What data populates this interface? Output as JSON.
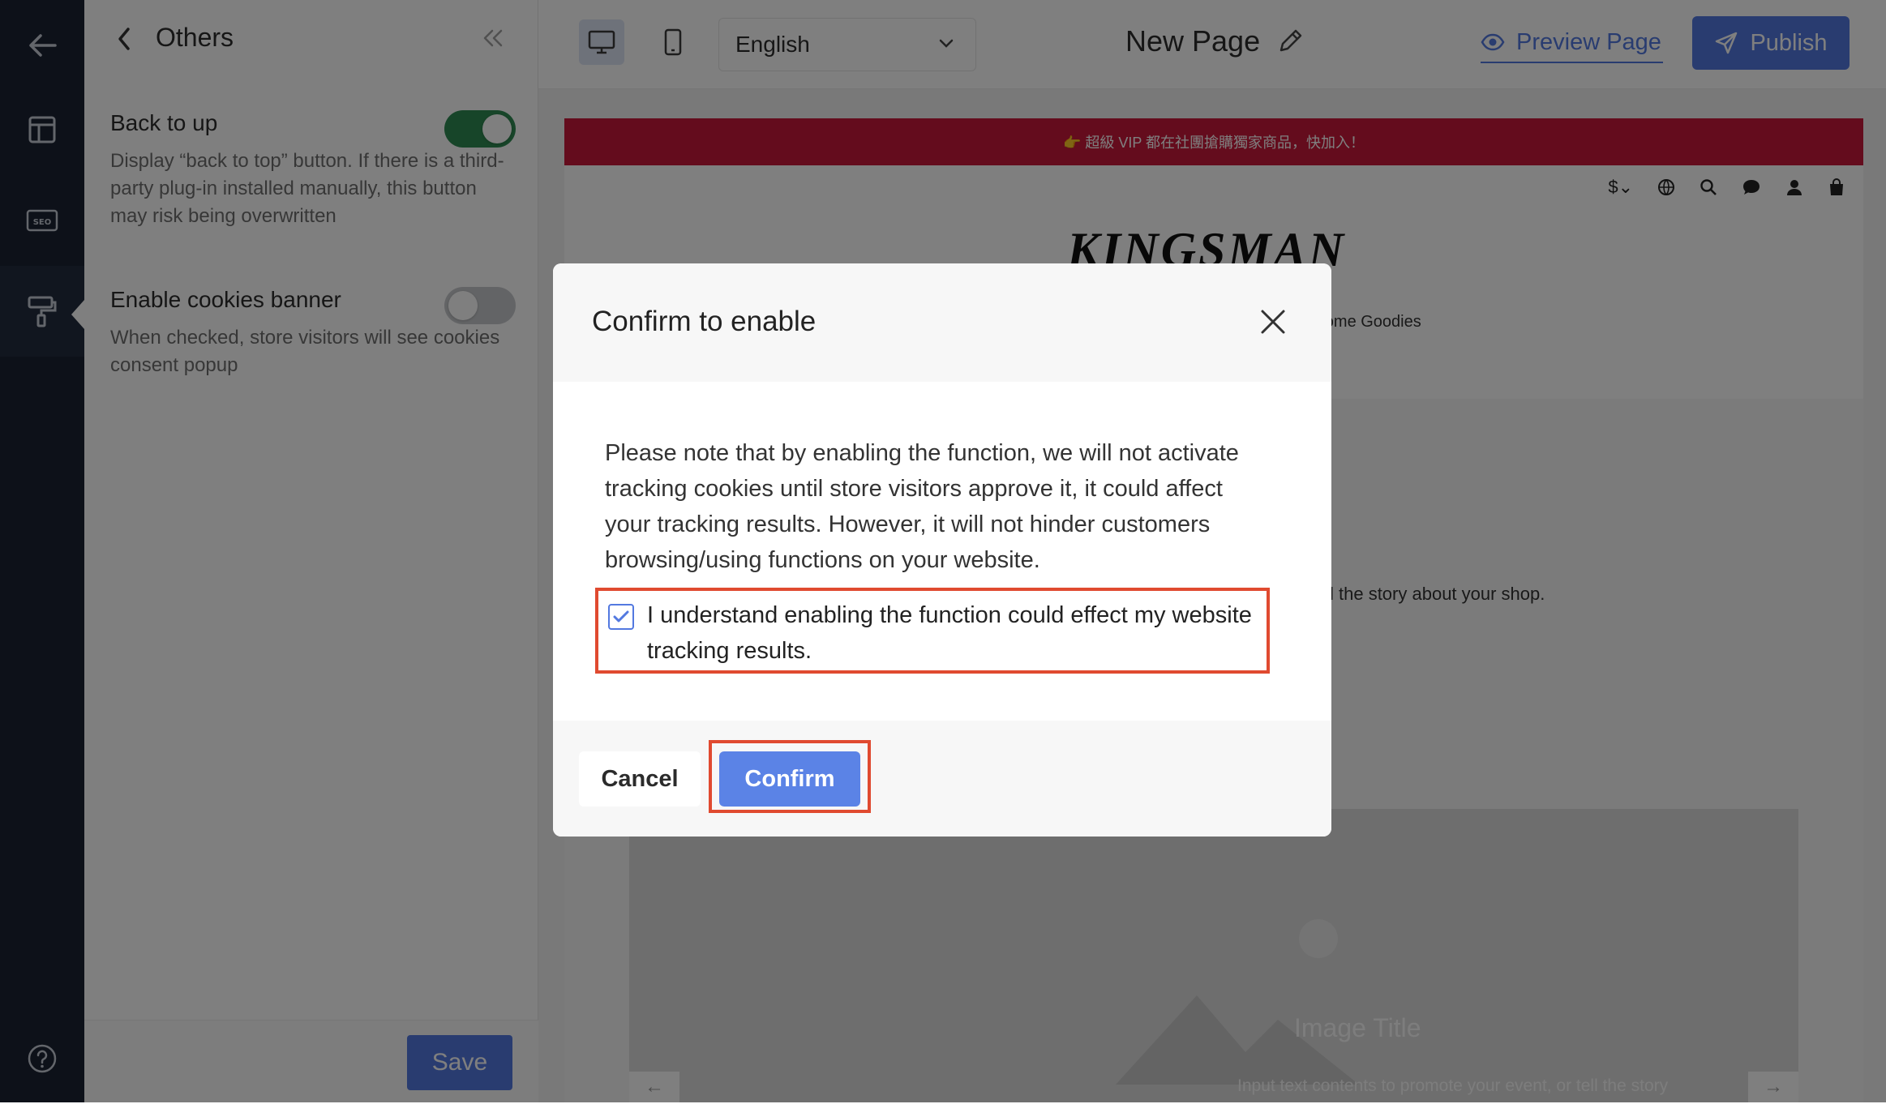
{
  "panel": {
    "title": "Others",
    "settings": [
      {
        "label": "Back to up",
        "description": "Display “back to top” button. If there is a third-party plug-in installed manually, this button may risk being overwritten",
        "enabled": true
      },
      {
        "label": "Enable cookies banner",
        "description": "When checked, store visitors will see cookies consent popup",
        "enabled": false
      }
    ],
    "save_label": "Save"
  },
  "topbar": {
    "language": "English",
    "page_title": "New Page",
    "preview_label": "Preview Page",
    "publish_label": "Publish"
  },
  "store": {
    "announcement": "👉 超級 VIP 都在社團搶購獨家商品，快加入！",
    "currency": "$",
    "logo": "KINGSMAN",
    "tagline_fragment": "y-home Goodies",
    "story_fragment": "l the story about your shop.",
    "image_title": "Image Title",
    "image_subtitle": "Input text contents to promote your event, or tell the story"
  },
  "modal": {
    "title": "Confirm to enable",
    "body": "Please note that by enabling the function, we will not activate tracking cookies until store visitors approve it, it could affect your tracking results. However, it will not hinder customers browsing/using functions on your website.",
    "acknowledge_label": "I understand enabling the function could effect my website tracking results.",
    "acknowledge_checked": true,
    "cancel_label": "Cancel",
    "confirm_label": "Confirm"
  },
  "colors": {
    "accent": "#5379e0",
    "toggle_on": "#2f8a52",
    "highlight": "#e04a30",
    "announcement_bg": "#c9183a",
    "rail_bg": "#1a2233"
  }
}
